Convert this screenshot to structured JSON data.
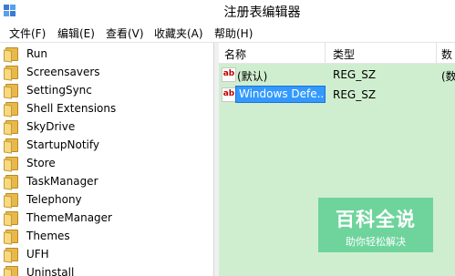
{
  "window": {
    "title": "注册表编辑器"
  },
  "menu": [
    "文件(F)",
    "编辑(E)",
    "查看(V)",
    "收藏夹(A)",
    "帮助(H)"
  ],
  "tree": {
    "items": [
      "Run",
      "Screensavers",
      "SettingSync",
      "Shell Extensions",
      "SkyDrive",
      "StartupNotify",
      "Store",
      "TaskManager",
      "Telephony",
      "ThemeManager",
      "Themes",
      "UFH",
      "Uninstall"
    ]
  },
  "list": {
    "columns": [
      "名称",
      "类型",
      "数"
    ],
    "rows": [
      {
        "name": "(默认)",
        "type": "REG_SZ",
        "data": "(数"
      },
      {
        "name_editing": "Windows Defe...",
        "type": "REG_SZ",
        "data": ""
      }
    ],
    "icon_glyph": "ab"
  },
  "watermark": {
    "title": "百科全说",
    "subtitle": "助你轻松解决"
  },
  "colors": {
    "list_bg": "#cfeecf",
    "selection": "#3399ff",
    "watermark": "#6fd49c"
  }
}
